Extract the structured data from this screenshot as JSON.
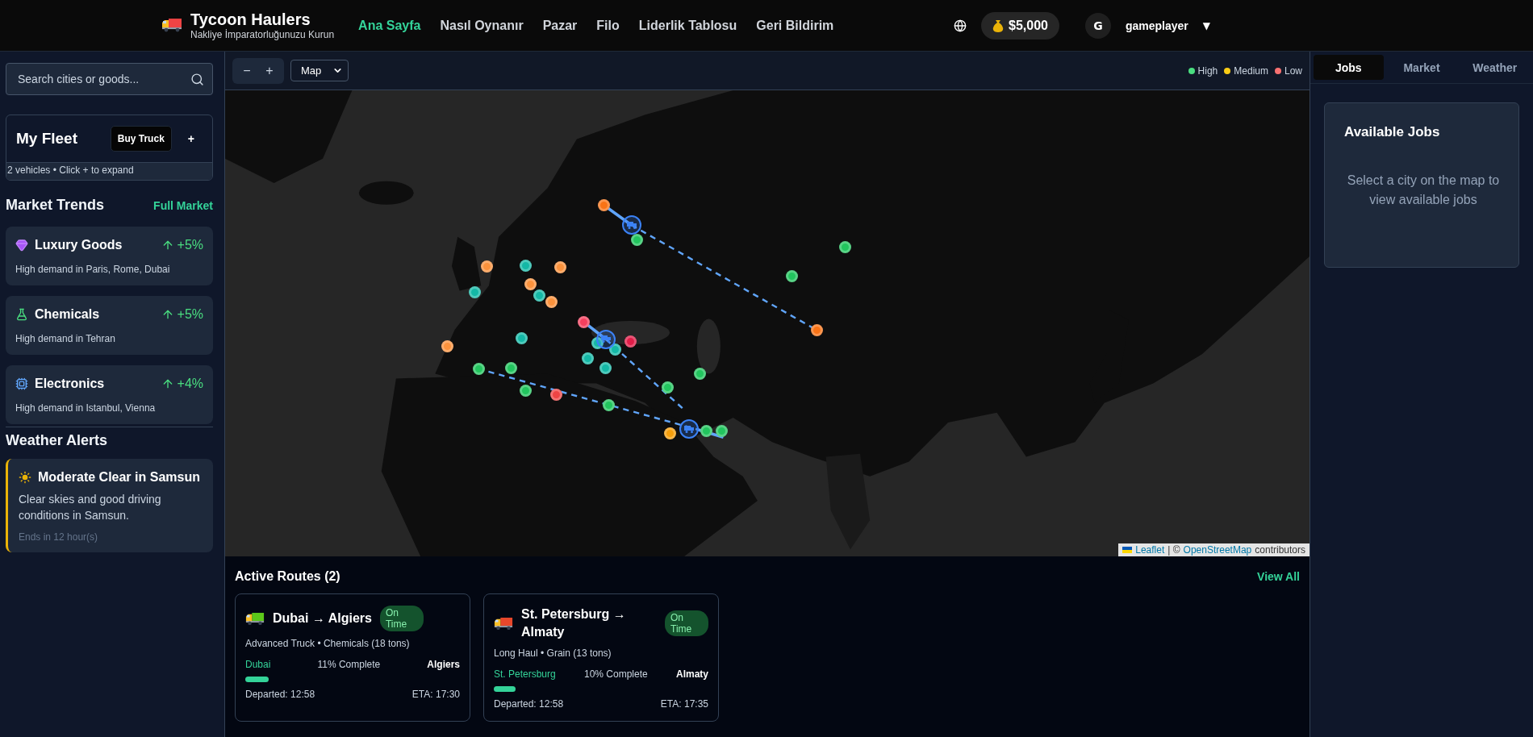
{
  "header": {
    "brand": "Tycoon Haulers",
    "tagline": "Nakliye İmparatorluğunuzu Kurun",
    "nav": [
      {
        "label": "Ana Sayfa",
        "selected": true
      },
      {
        "label": "Nasıl Oynanır",
        "selected": false
      },
      {
        "label": "Pazar",
        "selected": false
      },
      {
        "label": "Filo",
        "selected": false
      },
      {
        "label": "Liderlik Tablosu",
        "selected": false
      },
      {
        "label": "Geri Bildirim",
        "selected": false
      }
    ],
    "balance": "$5,000",
    "user": {
      "initial": "G",
      "name": "gameplayer",
      "caret": "▼"
    }
  },
  "sidebar": {
    "search": {
      "placeholder": "Search cities or goods..."
    },
    "fleet": {
      "title": "My Fleet",
      "buy_button": "Buy Truck",
      "expand_button": "+",
      "summary": "2 vehicles • Click + to expand"
    },
    "market_trends": {
      "title": "Market Trends",
      "link": "Full Market",
      "items": [
        {
          "kind": "luxury",
          "name": "Luxury Goods",
          "change": "+5%",
          "note": "High demand in Paris, Rome, Dubai"
        },
        {
          "kind": "chemical",
          "name": "Chemicals",
          "change": "+5%",
          "note": "High demand in Tehran"
        },
        {
          "kind": "electronics",
          "name": "Electronics",
          "change": "+4%",
          "note": "High demand in Istanbul, Vienna"
        }
      ]
    },
    "weather": {
      "title": "Weather Alerts",
      "alerts": [
        {
          "title": "Moderate Clear in Samsun",
          "text": "Clear skies and good driving conditions in Samsun.",
          "ends": "Ends in 12 hour(s)"
        }
      ]
    }
  },
  "map": {
    "zoom_out": "−",
    "zoom_in": "+",
    "layer_select": "Map",
    "legend": [
      {
        "label": "High",
        "color": "#4ade80"
      },
      {
        "label": "Medium",
        "color": "#facc15"
      },
      {
        "label": "Low",
        "color": "#f87171"
      }
    ],
    "markers": [
      {
        "kind": "city",
        "color": "#f97316"
      },
      {
        "kind": "city",
        "color": "#22c55e"
      },
      {
        "kind": "city",
        "color": "#22c55e"
      },
      {
        "kind": "city",
        "color": "#22c55e"
      },
      {
        "kind": "city",
        "color": "#f97316"
      },
      {
        "kind": "city",
        "color": "#fb923c"
      },
      {
        "kind": "city",
        "color": "#14b8a6"
      },
      {
        "kind": "city",
        "color": "#fb923c"
      },
      {
        "kind": "city",
        "color": "#14b8a6"
      },
      {
        "kind": "city",
        "color": "#fb923c"
      },
      {
        "kind": "city",
        "color": "#14b8a6"
      },
      {
        "kind": "city",
        "color": "#fb923c"
      },
      {
        "kind": "city",
        "color": "#f43f5e"
      },
      {
        "kind": "city",
        "color": "#e11d48"
      },
      {
        "kind": "city",
        "color": "#14b8a6"
      },
      {
        "kind": "city",
        "color": "#14b8a6"
      },
      {
        "kind": "city",
        "color": "#14b8a6"
      },
      {
        "kind": "city",
        "color": "#14b8a6"
      },
      {
        "kind": "city",
        "color": "#14b8a6"
      },
      {
        "kind": "city",
        "color": "#fb923c"
      },
      {
        "kind": "city",
        "color": "#22c55e"
      },
      {
        "kind": "city",
        "color": "#22c55e"
      },
      {
        "kind": "city",
        "color": "#22c55e"
      },
      {
        "kind": "city",
        "color": "#ef4444"
      },
      {
        "kind": "city",
        "color": "#22c55e"
      },
      {
        "kind": "city",
        "color": "#22c55e"
      },
      {
        "kind": "city",
        "color": "#22c55e"
      },
      {
        "kind": "city",
        "color": "#f59e0b"
      },
      {
        "kind": "city",
        "color": "#22c55e"
      },
      {
        "kind": "city",
        "color": "#22c55e"
      },
      {
        "kind": "truck",
        "color": "#3b82f6"
      },
      {
        "kind": "truck",
        "color": "#3b82f6"
      },
      {
        "kind": "truck",
        "color": "#3b82f6"
      }
    ],
    "attribution": {
      "link_1": "Leaflet",
      "separator": "| ©",
      "link_2": "OpenStreetMap",
      "suffix": "contributors"
    }
  },
  "active_routes": {
    "title": "Active Routes (2)",
    "link": "View All",
    "routes": [
      {
        "color": "#5cc81a",
        "title": "Dubai → Algiers",
        "status": "On Time",
        "details": "Advanced Truck • Chemicals (18 tons)",
        "from": "Dubai",
        "progress": "11% Complete",
        "to": "Algiers",
        "level": 0.11,
        "departed": "Departed: 12:58",
        "eta": "ETA: 17:30"
      },
      {
        "color": "#e8472b",
        "title": "St. Petersburg → Almaty",
        "status": "On Time",
        "details": "Long Haul • Grain (13 tons)",
        "from": "St. Petersburg",
        "progress": "10% Complete",
        "to": "Almaty",
        "level": 0.1,
        "departed": "Departed: 12:58",
        "eta": "ETA: 17:35"
      }
    ]
  },
  "right_panel": {
    "tabs": [
      {
        "label": "Jobs",
        "selected": true
      },
      {
        "label": "Market",
        "selected": false
      },
      {
        "label": "Weather",
        "selected": false
      }
    ],
    "title": "Available Jobs",
    "message": "Select a city on the map to view available jobs"
  }
}
